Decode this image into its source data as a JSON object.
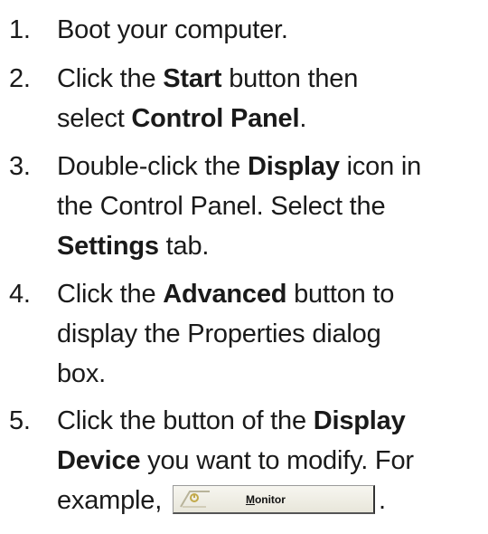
{
  "steps": [
    {
      "number": "1.",
      "lines": [
        [
          {
            "text": "Boot your computer.",
            "bold": false
          }
        ]
      ]
    },
    {
      "number": "2.",
      "lines": [
        [
          {
            "text": "Click the ",
            "bold": false
          },
          {
            "text": "Start",
            "bold": true
          },
          {
            "text": " button then",
            "bold": false
          }
        ],
        [
          {
            "text": "select ",
            "bold": false
          },
          {
            "text": "Control Panel",
            "bold": true
          },
          {
            "text": ".",
            "bold": false
          }
        ]
      ]
    },
    {
      "number": "3.",
      "lines": [
        [
          {
            "text": "Double-click the ",
            "bold": false
          },
          {
            "text": "Display",
            "bold": true
          },
          {
            "text": " icon in",
            "bold": false
          }
        ],
        [
          {
            "text": "the Control Panel. Select the",
            "bold": false
          }
        ],
        [
          {
            "text": "Settings",
            "bold": true
          },
          {
            "text": " tab.",
            "bold": false
          }
        ]
      ]
    },
    {
      "number": "4.",
      "lines": [
        [
          {
            "text": "Click the ",
            "bold": false
          },
          {
            "text": "Advanced",
            "bold": true
          },
          {
            "text": " button to",
            "bold": false
          }
        ],
        [
          {
            "text": "display the Properties dialog",
            "bold": false
          }
        ],
        [
          {
            "text": "box.",
            "bold": false
          }
        ]
      ]
    },
    {
      "number": "5.",
      "lines": [
        [
          {
            "text": "Click the button of the ",
            "bold": false
          },
          {
            "text": "Display",
            "bold": true
          }
        ],
        [
          {
            "text": "Device",
            "bold": true
          },
          {
            "text": " you want to modify. For",
            "bold": false
          }
        ],
        [
          {
            "text": "example, ",
            "bold": false
          }
        ]
      ],
      "trailing_text": "."
    }
  ],
  "monitor_button": {
    "accelerator": "M",
    "label_rest": "onitor",
    "icon": "monitor-tab-icon"
  }
}
